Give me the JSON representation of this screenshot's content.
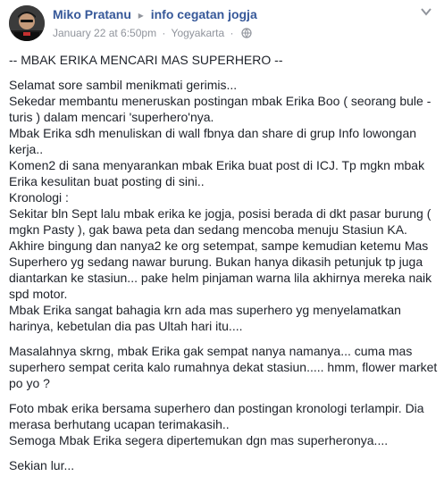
{
  "post": {
    "author": "Miko Pratanu",
    "group": "info cegatan jogja",
    "timestamp": "January 22 at 6:50pm",
    "location": "Yogyakarta",
    "dot": "·",
    "paragraphs": [
      "-- MBAK ERIKA MENCARI MAS SUPERHERO --",
      "Selamat sore sambil menikmati gerimis...\nSekedar membantu meneruskan postingan mbak Erika Boo ( seorang bule - turis ) dalam mencari 'superhero'nya.\nMbak Erika sdh menuliskan di wall fbnya dan share di grup Info lowongan kerja..\nKomen2 di sana menyarankan mbak Erika buat post di ICJ. Tp mgkn mbak Erika kesulitan buat posting di sini..\nKronologi :\nSekitar bln Sept lalu mbak erika ke jogja, posisi berada di dkt pasar burung ( mgkn Pasty ), gak bawa peta dan sedang mencoba menuju Stasiun KA.\nAkhire bingung dan nanya2 ke org setempat, sampe kemudian ketemu Mas Superhero yg sedang nawar burung. Bukan hanya dikasih petunjuk tp juga diantarkan ke stasiun... pake helm pinjaman warna lila akhirnya mereka naik spd motor.\nMbak Erika sangat bahagia krn ada mas superhero yg menyelamatkan harinya, kebetulan dia pas Ultah hari itu....",
      "Masalahnya skrng, mbak Erika gak sempat nanya namanya... cuma mas superhero sempat cerita kalo rumahnya dekat stasiun..... hmm, flower market po yo ?",
      "Foto mbak erika bersama superhero dan postingan kronologi terlampir. Dia merasa berhutang ucapan terimakasih..\nSemoga Mbak Erika segera dipertemukan dgn mas superheronya....",
      "Sekian lur..."
    ]
  }
}
